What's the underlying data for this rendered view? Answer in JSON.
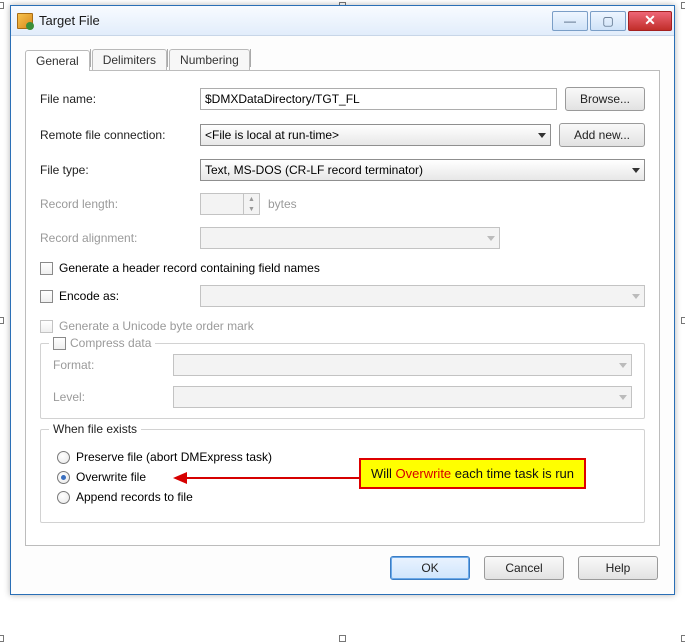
{
  "window": {
    "title": "Target File"
  },
  "tabs": {
    "general": "General",
    "delimiters": "Delimiters",
    "numbering": "Numbering"
  },
  "fields": {
    "file_name_label": "File name:",
    "file_name_value": "$DMXDataDirectory/TGT_FL",
    "browse": "Browse...",
    "remote_label": "Remote file connection:",
    "remote_value": "<File is local at run-time>",
    "add_new": "Add new...",
    "file_type_label": "File type:",
    "file_type_value": "Text, MS-DOS (CR-LF record terminator)",
    "record_length_label": "Record length:",
    "record_length_unit": "bytes",
    "record_alignment_label": "Record alignment:",
    "gen_header": "Generate a header record containing field names",
    "encode_as": "Encode as:",
    "gen_bom": "Generate a Unicode byte order mark",
    "compress": "Compress data",
    "format_label": "Format:",
    "level_label": "Level:",
    "when_exists": "When file exists",
    "preserve": "Preserve file (abort DMExpress task)",
    "overwrite": "Overwrite file",
    "append": "Append records to file"
  },
  "callout": {
    "pre": "Will ",
    "hl": "Overwrite",
    "post": " each time task is run"
  },
  "buttons": {
    "ok": "OK",
    "cancel": "Cancel",
    "help": "Help"
  }
}
